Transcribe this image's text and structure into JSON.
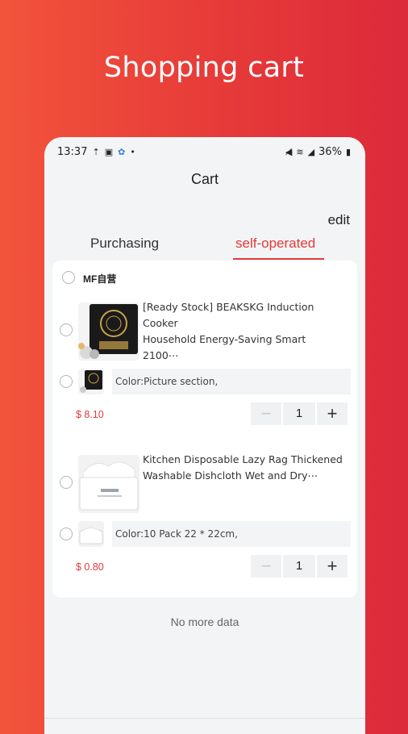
{
  "promo": {
    "title": "Shopping cart"
  },
  "status_bar": {
    "time": "13:37",
    "battery": "36%"
  },
  "header": {
    "title": "Cart",
    "edit_label": "edit"
  },
  "tabs": [
    {
      "label": "Purchasing",
      "active": false
    },
    {
      "label": "self-operated",
      "active": true
    }
  ],
  "store": {
    "name": "MF自营"
  },
  "items": [
    {
      "title_line1": "[Ready Stock] BEAKSKG Induction Cooker",
      "title_line2": "Household Energy-Saving Smart 2100⋯",
      "variant": "Color:Picture section,",
      "price": "$ 8.10",
      "quantity": "1"
    },
    {
      "title_line1": "Kitchen Disposable Lazy Rag Thickened",
      "title_line2": "Washable Dishcloth Wet and Dry⋯",
      "variant": "Color:10 Pack 22 * 22cm,",
      "price": "$ 0.80",
      "quantity": "1"
    }
  ],
  "footer": {
    "no_more": "No more data"
  },
  "colors": {
    "accent": "#e23a3a",
    "gradient_start": "#f2543b",
    "gradient_end": "#dc2a3a"
  },
  "stepper": {
    "minus": "−",
    "plus": "+"
  }
}
